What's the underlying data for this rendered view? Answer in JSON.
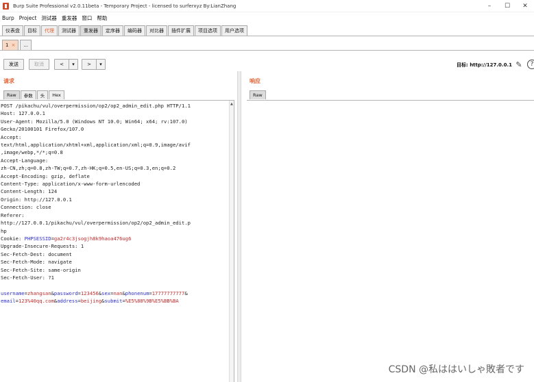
{
  "window": {
    "title": "Burp Suite Professional v2.0.11beta - Temporary Project - licensed to surferxyz By:LianZhang",
    "controls": [
      "–",
      "☐",
      "✕"
    ]
  },
  "menu": [
    "Burp",
    "Project",
    "测试器",
    "重发器",
    "窗口",
    "帮助"
  ],
  "main_tabs": [
    "仪表盘",
    "目标",
    "代理",
    "测试器",
    "重发器",
    "定序器",
    "编码器",
    "对比器",
    "插件扩展",
    "项目选项",
    "用户选项"
  ],
  "sub_tabs": {
    "first": "1",
    "first_close": "×",
    "more": "..."
  },
  "toolbar": {
    "send": "发送",
    "cancel": "取消",
    "back": "<",
    "back_menu": "▾",
    "forward": ">",
    "forward_menu": "▾",
    "target_label": "目标: http://127.0.0.1",
    "edit_icon": "✎",
    "help_icon": "?"
  },
  "request": {
    "title": "请求",
    "tabs": [
      "Raw",
      "参数",
      "头",
      "Hex"
    ],
    "lines": [
      "POST /pikachu/vul/overpermission/op2/op2_admin_edit.php HTTP/1.1",
      "Host: 127.0.0.1",
      "User-Agent: Mozilla/5.0 (Windows NT 10.0; Win64; x64; rv:107.0)",
      "Gecko/20100101 Firefox/107.0",
      "Accept:",
      "text/html,application/xhtml+xml,application/xml;q=0.9,image/avif",
      ",image/webp,*/*;q=0.8",
      "Accept-Language:",
      "zh-CN,zh;q=0.8,zh-TW;q=0.7,zh-HK;q=0.5,en-US;q=0.3,en;q=0.2",
      "Accept-Encoding: gzip, deflate",
      "Content-Type: application/x-www-form-urlencoded",
      "Content-Length: 124",
      "Origin: http://127.0.0.1",
      "Connection: close",
      "Referer:",
      "http://127.0.0.1/pikachu/vul/overpermission/op2/op2_admin_edit.p",
      "hp"
    ],
    "cookie_name": "Cookie: ",
    "cookie_key": "PHPSESSID",
    "cookie_eq": "=",
    "cookie_val": "ga2r4c3jsogjh8k9haoa476ug6",
    "lines2": [
      "Upgrade-Insecure-Requests: 1",
      "Sec-Fetch-Dest: document",
      "Sec-Fetch-Mode: navigate",
      "Sec-Fetch-Site: same-origin",
      "Sec-Fetch-User: ?1",
      ""
    ],
    "body": {
      "p1k": "username",
      "p1v": "zhangsan",
      "p2k": "password",
      "p2v": "123456",
      "p3k": "sex",
      "p3v": "nan",
      "p4k": "phonenum",
      "p4v": "17777777777",
      "p5k": "email",
      "p5v": "123%40qq.com",
      "p6k": "address",
      "p6v": "beijing",
      "p7k": "submit",
      "p7v": "%E5%88%9B%E5%BB%BA"
    }
  },
  "response": {
    "title": "响应",
    "tabs": [
      "Raw"
    ]
  },
  "watermark": "CSDN @私ははいしゃ敗者です"
}
